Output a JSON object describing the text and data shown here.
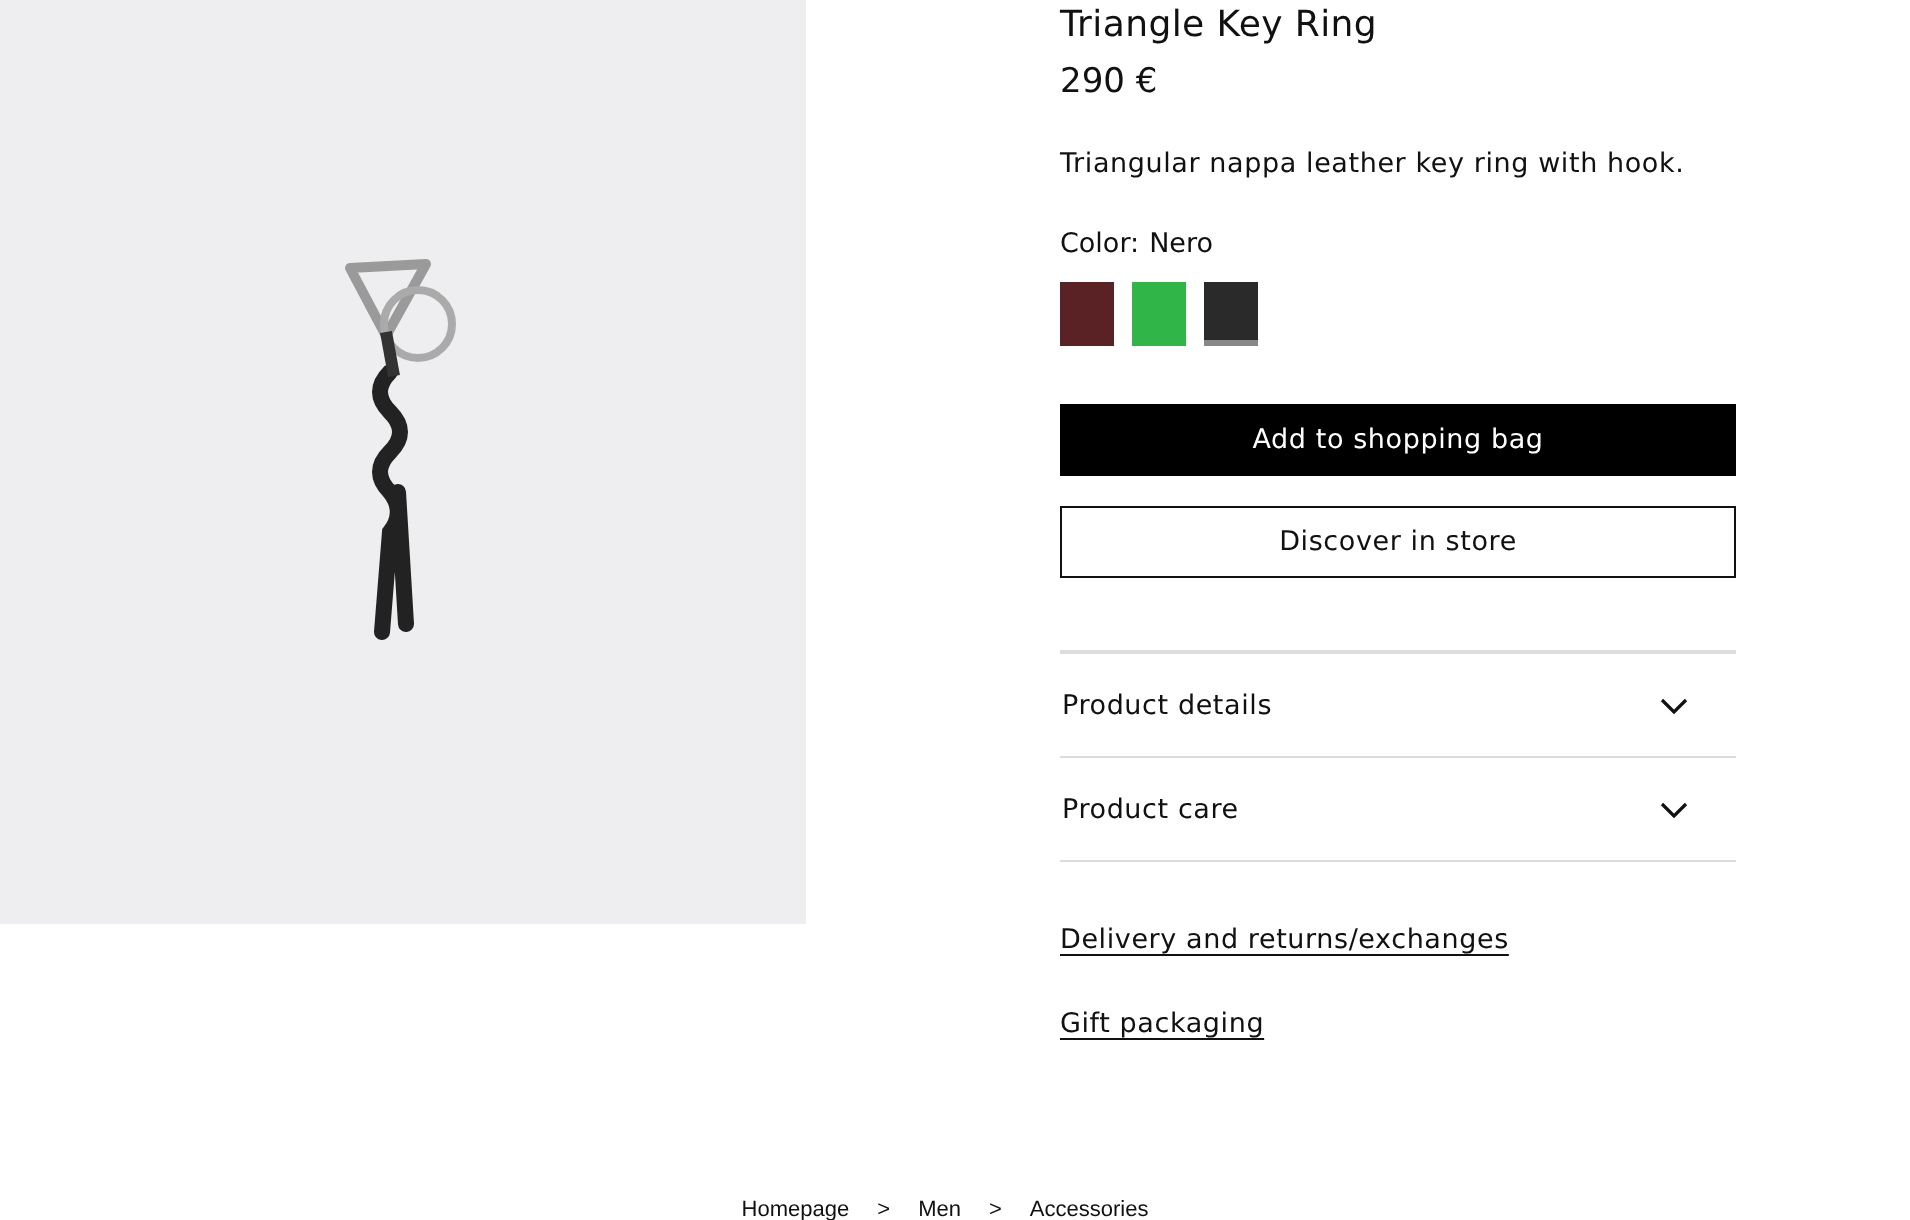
{
  "product": {
    "title": "Triangle Key Ring",
    "price": "290 €",
    "description": "Triangular nappa leather key ring with hook.",
    "color_label": "Color:",
    "color_value": "Nero"
  },
  "swatches": [
    {
      "color": "#5a2224",
      "selected": false
    },
    {
      "color": "#2fb548",
      "selected": false
    },
    {
      "color": "#2a2a2a",
      "selected": true
    }
  ],
  "buttons": [
    {
      "kind": "primary",
      "label": "Add to shopping bag"
    },
    {
      "kind": "secondary",
      "label": "Discover in store"
    }
  ],
  "accordion": [
    {
      "label": "Product details",
      "expanded": false
    },
    {
      "label": "Product care",
      "expanded": false
    }
  ],
  "links": [
    "Delivery and returns/exchanges",
    "Gift packaging"
  ],
  "breadcrumb": [
    "Homepage",
    "Men",
    "Accessories"
  ],
  "breadcrumb_separator": ">"
}
